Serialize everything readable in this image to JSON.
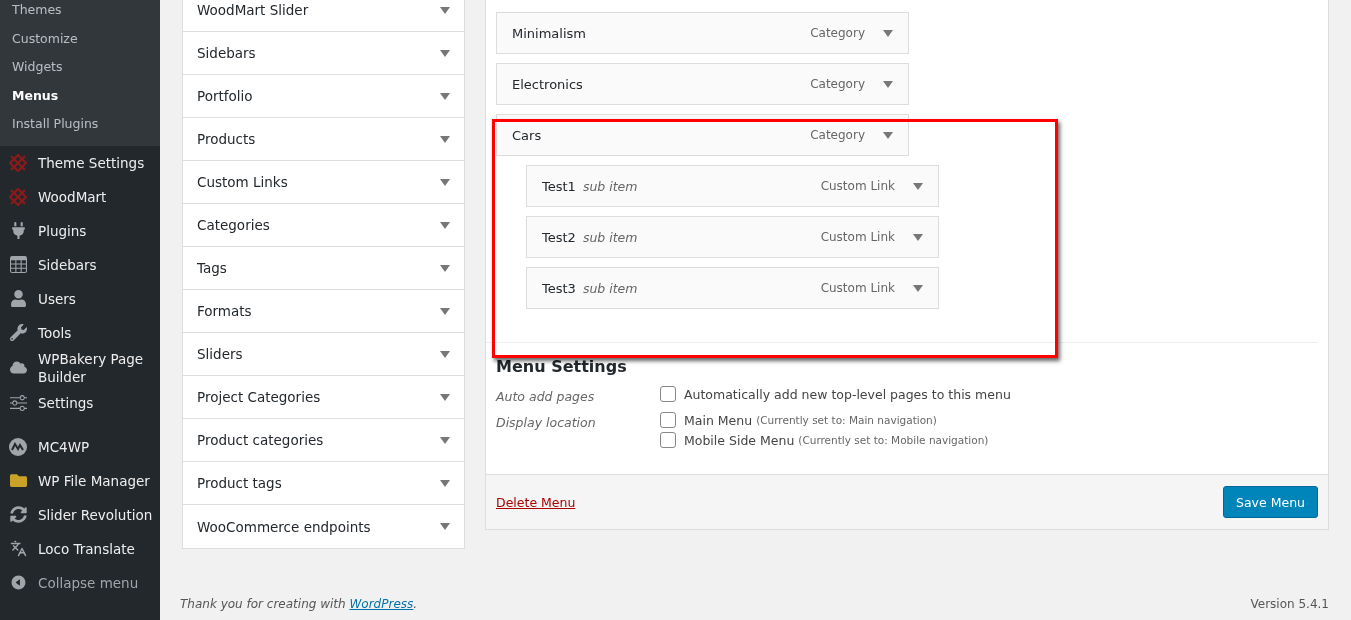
{
  "sidebar": {
    "submenu": [
      {
        "label": "Themes",
        "current": false
      },
      {
        "label": "Customize",
        "current": false
      },
      {
        "label": "Widgets",
        "current": false
      },
      {
        "label": "Menus",
        "current": true
      },
      {
        "label": "Install Plugins",
        "current": false
      }
    ],
    "groups": [
      {
        "items": [
          {
            "label": "Theme Settings"
          },
          {
            "label": "WoodMart"
          },
          {
            "label": "Plugins"
          },
          {
            "label": "Sidebars"
          },
          {
            "label": "Users"
          },
          {
            "label": "Tools"
          },
          {
            "label": "WPBakery Page Builder"
          },
          {
            "label": "Settings"
          }
        ]
      },
      {
        "items": [
          {
            "label": "MC4WP"
          },
          {
            "label": "WP File Manager"
          },
          {
            "label": "Slider Revolution"
          },
          {
            "label": "Loco Translate"
          }
        ]
      }
    ],
    "collapse": "Collapse menu"
  },
  "add_items": [
    {
      "label": "WoodMart Slider",
      "expanded": false
    },
    {
      "label": "Sidebars",
      "expanded": false
    },
    {
      "label": "Portfolio",
      "expanded": false
    },
    {
      "label": "Products",
      "expanded": false
    },
    {
      "label": "Custom Links",
      "expanded": false
    },
    {
      "label": "Categories",
      "expanded": false
    },
    {
      "label": "Tags",
      "expanded": false
    },
    {
      "label": "Formats",
      "expanded": false
    },
    {
      "label": "Sliders",
      "expanded": false
    },
    {
      "label": "Project Categories",
      "expanded": false
    },
    {
      "label": "Product categories",
      "expanded": false
    },
    {
      "label": "Product tags",
      "expanded": false
    },
    {
      "label": "WooCommerce endpoints",
      "expanded": false
    }
  ],
  "menu_items": [
    {
      "title": "Minimalism",
      "type": "Category"
    },
    {
      "title": "Electronics",
      "type": "Category"
    },
    {
      "title": "Cars",
      "type": "Category",
      "children": [
        {
          "title": "Test1",
          "note": "sub item",
          "type": "Custom Link"
        },
        {
          "title": "Test2",
          "note": "sub item",
          "type": "Custom Link"
        },
        {
          "title": "Test3",
          "note": "sub item",
          "type": "Custom Link"
        }
      ]
    }
  ],
  "menu_settings": {
    "heading": "Menu Settings",
    "rows": [
      {
        "label": "Auto add pages",
        "options": [
          {
            "label": "Automatically add new top-level pages to this menu",
            "checked": false
          }
        ]
      },
      {
        "label": "Display location",
        "options": [
          {
            "label": "Main Menu",
            "hint": "(Currently set to: Main navigation)",
            "checked": false
          },
          {
            "label": "Mobile Side Menu",
            "hint": "(Currently set to: Mobile navigation)",
            "checked": false
          }
        ]
      }
    ]
  },
  "delete_link": "Delete Menu",
  "save_button": "Save Menu",
  "footer": {
    "thanks": "Thank you for creating with ",
    "link": "WordPress",
    "end": ".",
    "version": "Version 5.4.1"
  }
}
